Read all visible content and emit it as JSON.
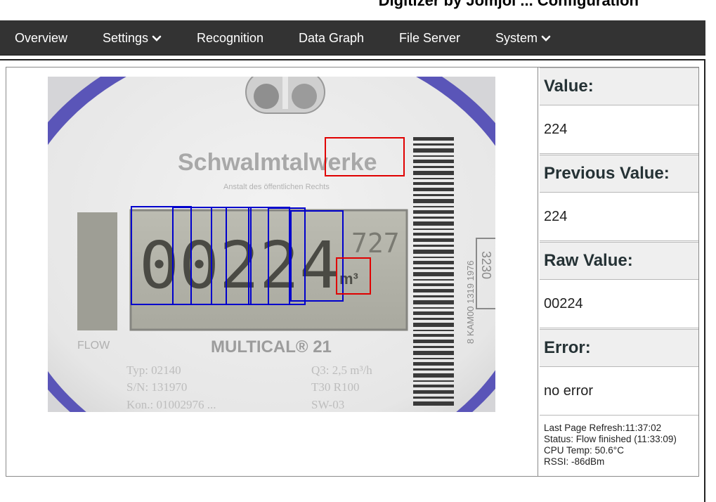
{
  "header": {
    "title": "Digitizer by Jomjol ... Configuration"
  },
  "nav": {
    "items": [
      {
        "label": "Overview"
      },
      {
        "label": "Settings"
      },
      {
        "label": "Recognition"
      },
      {
        "label": "Data Graph"
      },
      {
        "label": "File Server"
      },
      {
        "label": "System"
      }
    ]
  },
  "meter": {
    "brand": "Schwalmtalwerke",
    "subtitle": "Anstalt des öffentlichen Rechts",
    "digits": "00224",
    "decimals": "727",
    "unit": "m³",
    "flow_label": "FLOW",
    "model": "MULTICAL® 21",
    "spec_q3": "Q3: 2,5 m³/h",
    "spec_t": "T30  R100",
    "spec_typ": "Typ: 02140",
    "spec_sn": "S/N: 131970",
    "spec_kon": "Kon.: 01002976 ...",
    "spec_sw": "SW-03",
    "barcode_text": "8 KAM00 1319 1976",
    "side_number": "3230"
  },
  "results": {
    "value_label": "Value:",
    "value": "224",
    "previous_label": "Previous Value:",
    "previous": "224",
    "raw_label": "Raw Value:",
    "raw": "00224",
    "error_label": "Error:",
    "error": "no error"
  },
  "status": {
    "refresh": "Last Page Refresh:11:37:02",
    "flow": "Status: Flow finished (11:33:09)",
    "cpu": "CPU Temp: 50.6°C",
    "rssi": "RSSI: -86dBm"
  },
  "colors": {
    "nav_bg": "#333333",
    "roi_digit": "#0000cc",
    "roi_align": "#e00000",
    "heading": "#253235"
  }
}
